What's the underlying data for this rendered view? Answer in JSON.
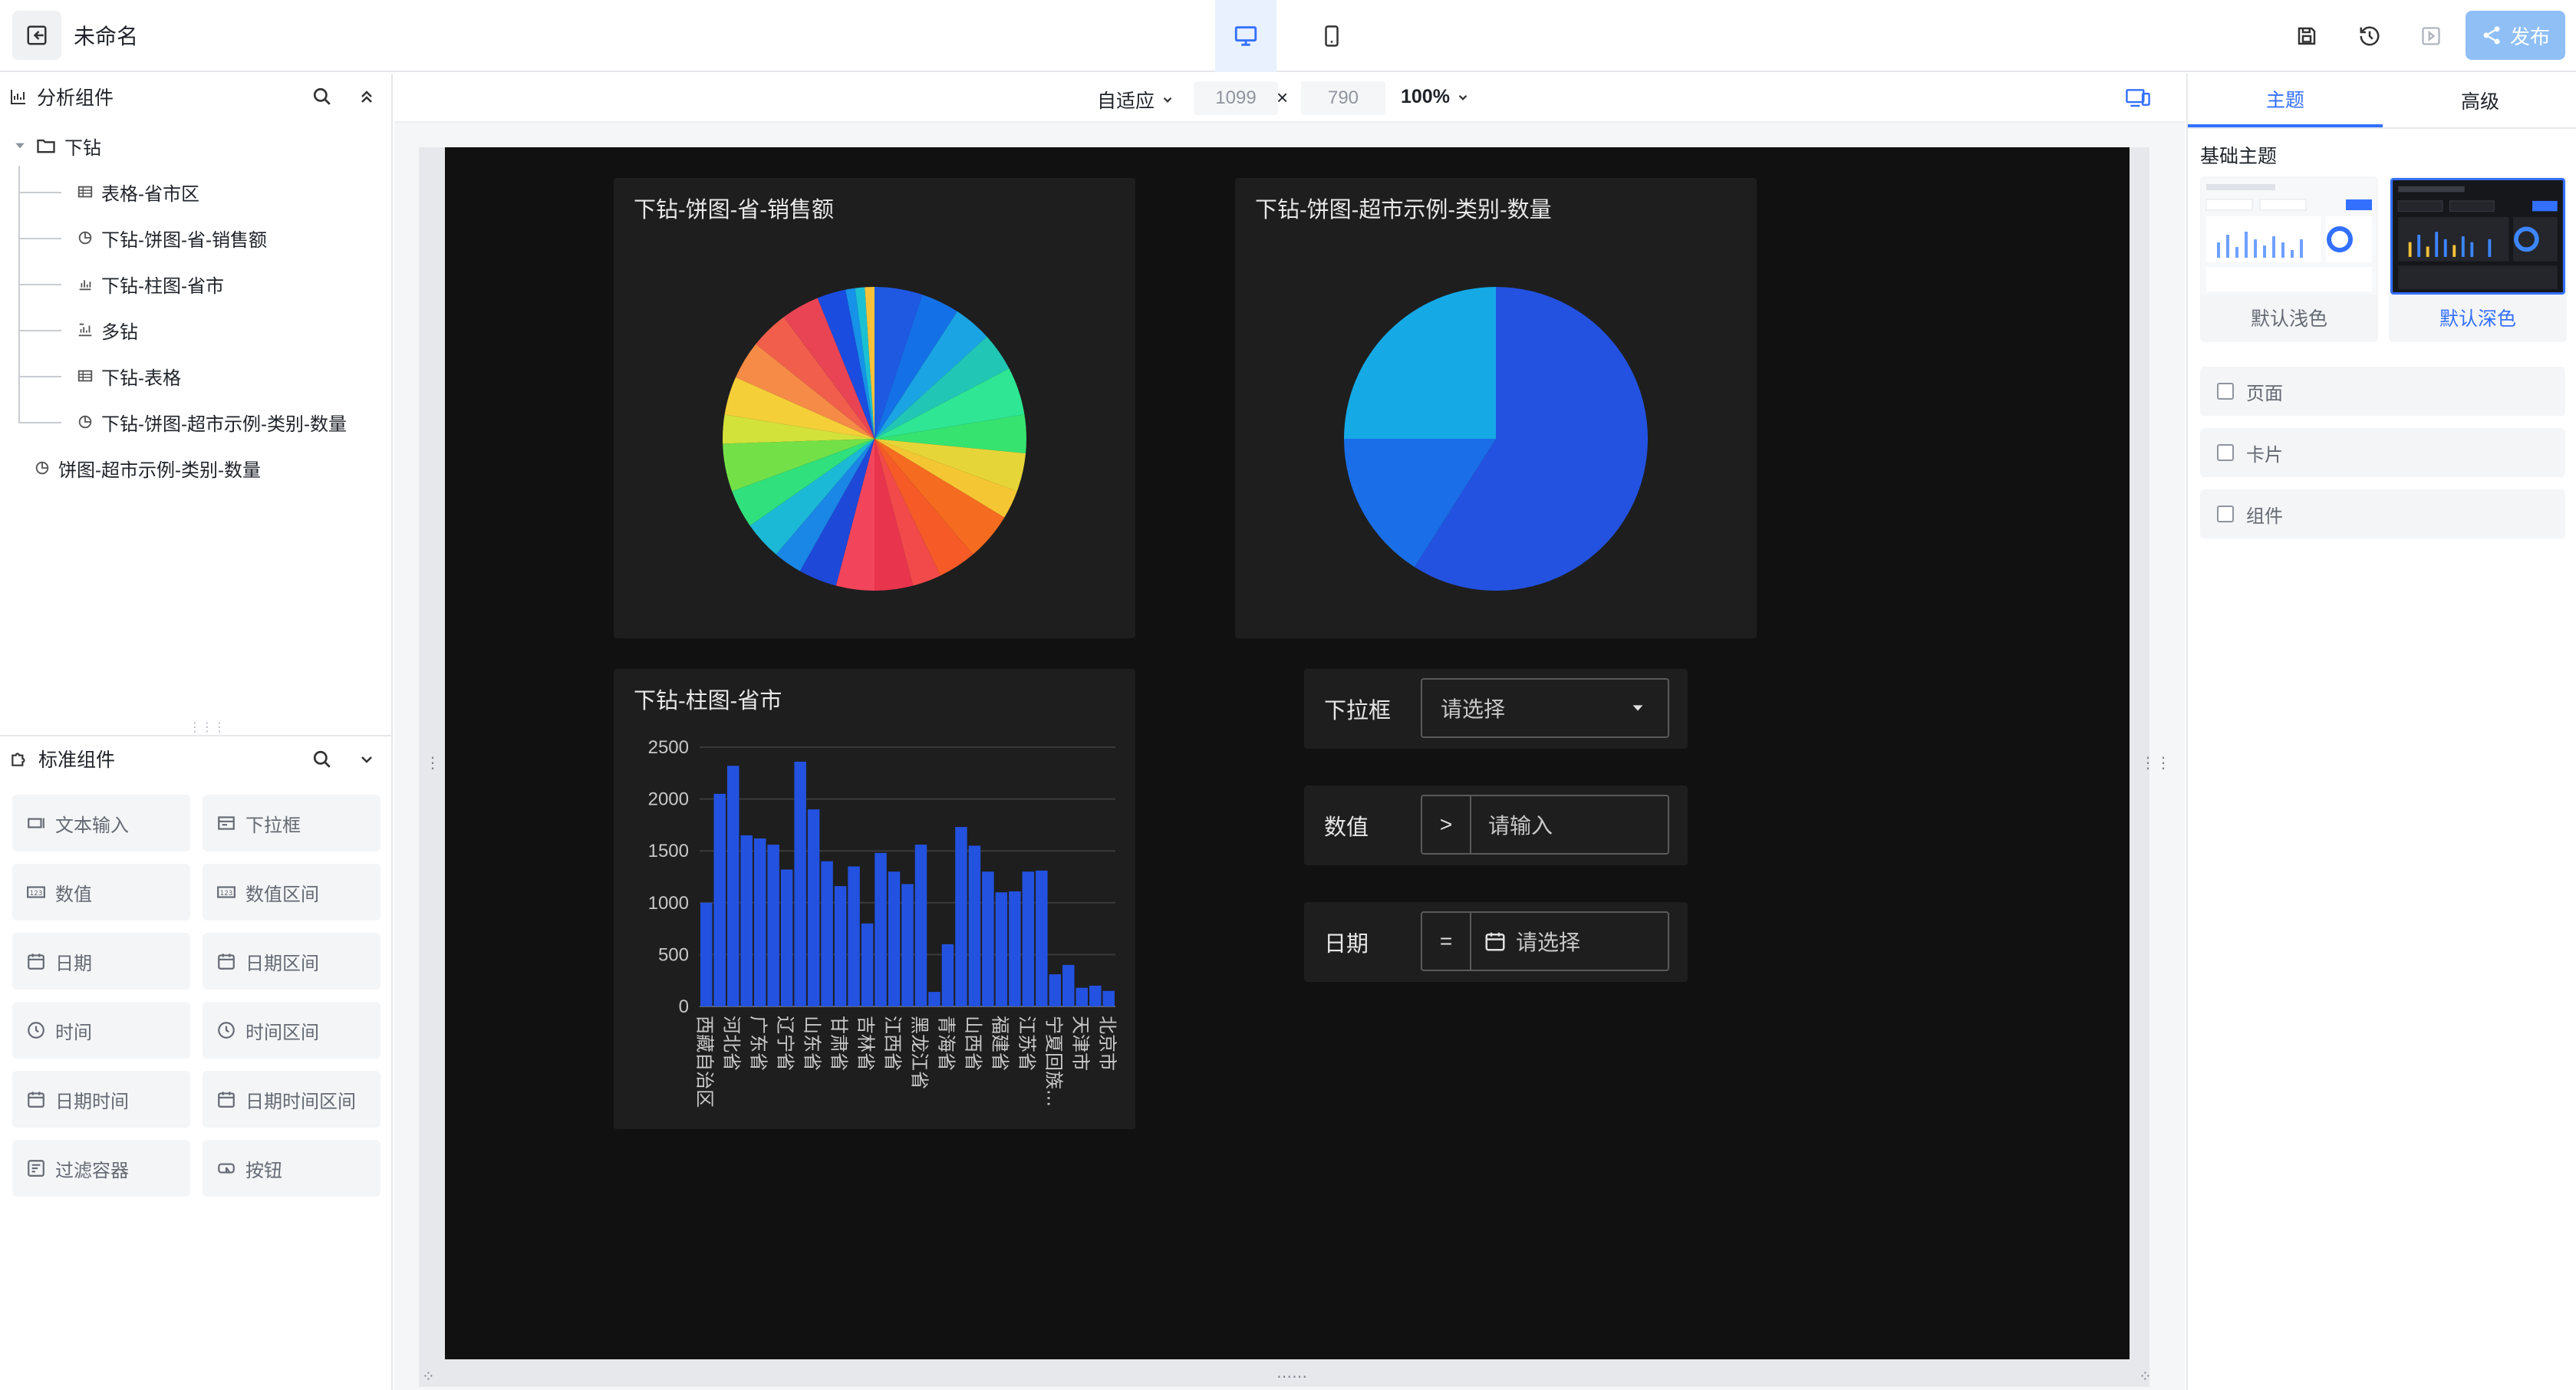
{
  "topbar": {
    "title": "未命名",
    "publish_label": "发布"
  },
  "left": {
    "analysis_header": "分析组件",
    "tree": [
      {
        "label": "下钻",
        "icon": "folder-icon",
        "level": 0
      },
      {
        "label": "表格-省市区",
        "icon": "table-icon",
        "level": 1
      },
      {
        "label": "下钻-饼图-省-销售额",
        "icon": "pie-icon",
        "level": 1
      },
      {
        "label": "下钻-柱图-省市",
        "icon": "bar-icon",
        "level": 1
      },
      {
        "label": "多钻",
        "icon": "multi-drill-icon",
        "level": 1
      },
      {
        "label": "下钻-表格",
        "icon": "table-icon",
        "level": 1
      },
      {
        "label": "下钻-饼图-超市示例-类别-数量",
        "icon": "pie-icon",
        "level": 1
      },
      {
        "label": "饼图-超市示例-类别-数量",
        "icon": "pie-icon",
        "level": 0
      }
    ],
    "standard_header": "标准组件",
    "components": [
      {
        "label": "文本输入",
        "icon": "text-input-icon"
      },
      {
        "label": "下拉框",
        "icon": "dropdown-icon"
      },
      {
        "label": "数值",
        "icon": "number-icon"
      },
      {
        "label": "数值区间",
        "icon": "number-range-icon"
      },
      {
        "label": "日期",
        "icon": "calendar-icon"
      },
      {
        "label": "日期区间",
        "icon": "calendar-range-icon"
      },
      {
        "label": "时间",
        "icon": "clock-icon"
      },
      {
        "label": "时间区间",
        "icon": "clock-range-icon"
      },
      {
        "label": "日期时间",
        "icon": "datetime-icon"
      },
      {
        "label": "日期时间区间",
        "icon": "datetime-range-icon"
      },
      {
        "label": "过滤容器",
        "icon": "filter-container-icon"
      },
      {
        "label": "按钮",
        "icon": "button-icon"
      }
    ]
  },
  "canvas": {
    "adapt_label": "自适应",
    "width_value": "1099",
    "height_value": "790",
    "times": "×",
    "zoom_label": "100%"
  },
  "dashboard": {
    "pie1_title": "下钻-饼图-省-销售额",
    "pie2_title": "下钻-饼图-超市示例-类别-数量",
    "bar_title": "下钻-柱图-省市",
    "filters": [
      {
        "label": "下拉框",
        "operator": "",
        "placeholder": "请选择"
      },
      {
        "label": "数值",
        "operator": ">",
        "placeholder": "请输入"
      },
      {
        "label": "日期",
        "operator": "=",
        "placeholder": "请选择"
      }
    ]
  },
  "chart_data": [
    {
      "type": "pie",
      "title": "下钻-饼图-省-销售额",
      "values": [
        5,
        4,
        4,
        4,
        5,
        4,
        4,
        3,
        5,
        4,
        3,
        4,
        4,
        4,
        3,
        4,
        4,
        5,
        3,
        4,
        4,
        4,
        4,
        3,
        1,
        1,
        1
      ],
      "colors": [
        "#1f59e2",
        "#1470e6",
        "#1aa4e3",
        "#21c6b5",
        "#2ee693",
        "#36e36f",
        "#e6d538",
        "#f5c633",
        "#f56b1f",
        "#f55a27",
        "#f24a4a",
        "#e8344d",
        "#f2455b",
        "#1e48d8",
        "#1a86e6",
        "#1cb9d6",
        "#2fe07c",
        "#74e048",
        "#d2e23a",
        "#f5cf38",
        "#f58b46",
        "#f15e4b",
        "#e84454",
        "#1a4ce0",
        "#1692e8",
        "#1bc1d2",
        "#f5c23a"
      ]
    },
    {
      "type": "pie",
      "title": "下钻-饼图-超市示例-类别-数量",
      "values": [
        59,
        16,
        25
      ],
      "colors": [
        "#2352e0",
        "#1a6ee8",
        "#15a9e6"
      ]
    },
    {
      "type": "bar",
      "title": "下钻-柱图-省市",
      "categories": [
        "西藏自治区",
        "",
        "河北省",
        "",
        "广东省",
        "",
        "辽宁省",
        "",
        "山东省",
        "",
        "甘肃省",
        "",
        "吉林省",
        "",
        "江西省",
        "",
        "黑龙江省",
        "",
        "青海省",
        "",
        "山西省",
        "",
        "福建省",
        "",
        "江苏省",
        "",
        "宁夏回族...",
        "",
        "天津市",
        "",
        "北京市"
      ],
      "values": [
        1000,
        2050,
        2320,
        1650,
        1620,
        1560,
        1320,
        2360,
        1900,
        1400,
        1160,
        1350,
        800,
        1480,
        1300,
        1180,
        1560,
        140,
        600,
        1730,
        1550,
        1300,
        1100,
        1110,
        1300,
        1310,
        310,
        400,
        180,
        200,
        150
      ],
      "ylim": [
        0,
        2500
      ],
      "yticks": [
        0,
        500,
        1000,
        1500,
        2000,
        2500
      ],
      "color": "#2352e0"
    }
  ],
  "right": {
    "tab_theme": "主题",
    "tab_advanced": "高级",
    "section_basic": "基础主题",
    "theme_light": "默认浅色",
    "theme_dark": "默认深色",
    "check_page": "页面",
    "check_card": "卡片",
    "check_component": "组件"
  }
}
